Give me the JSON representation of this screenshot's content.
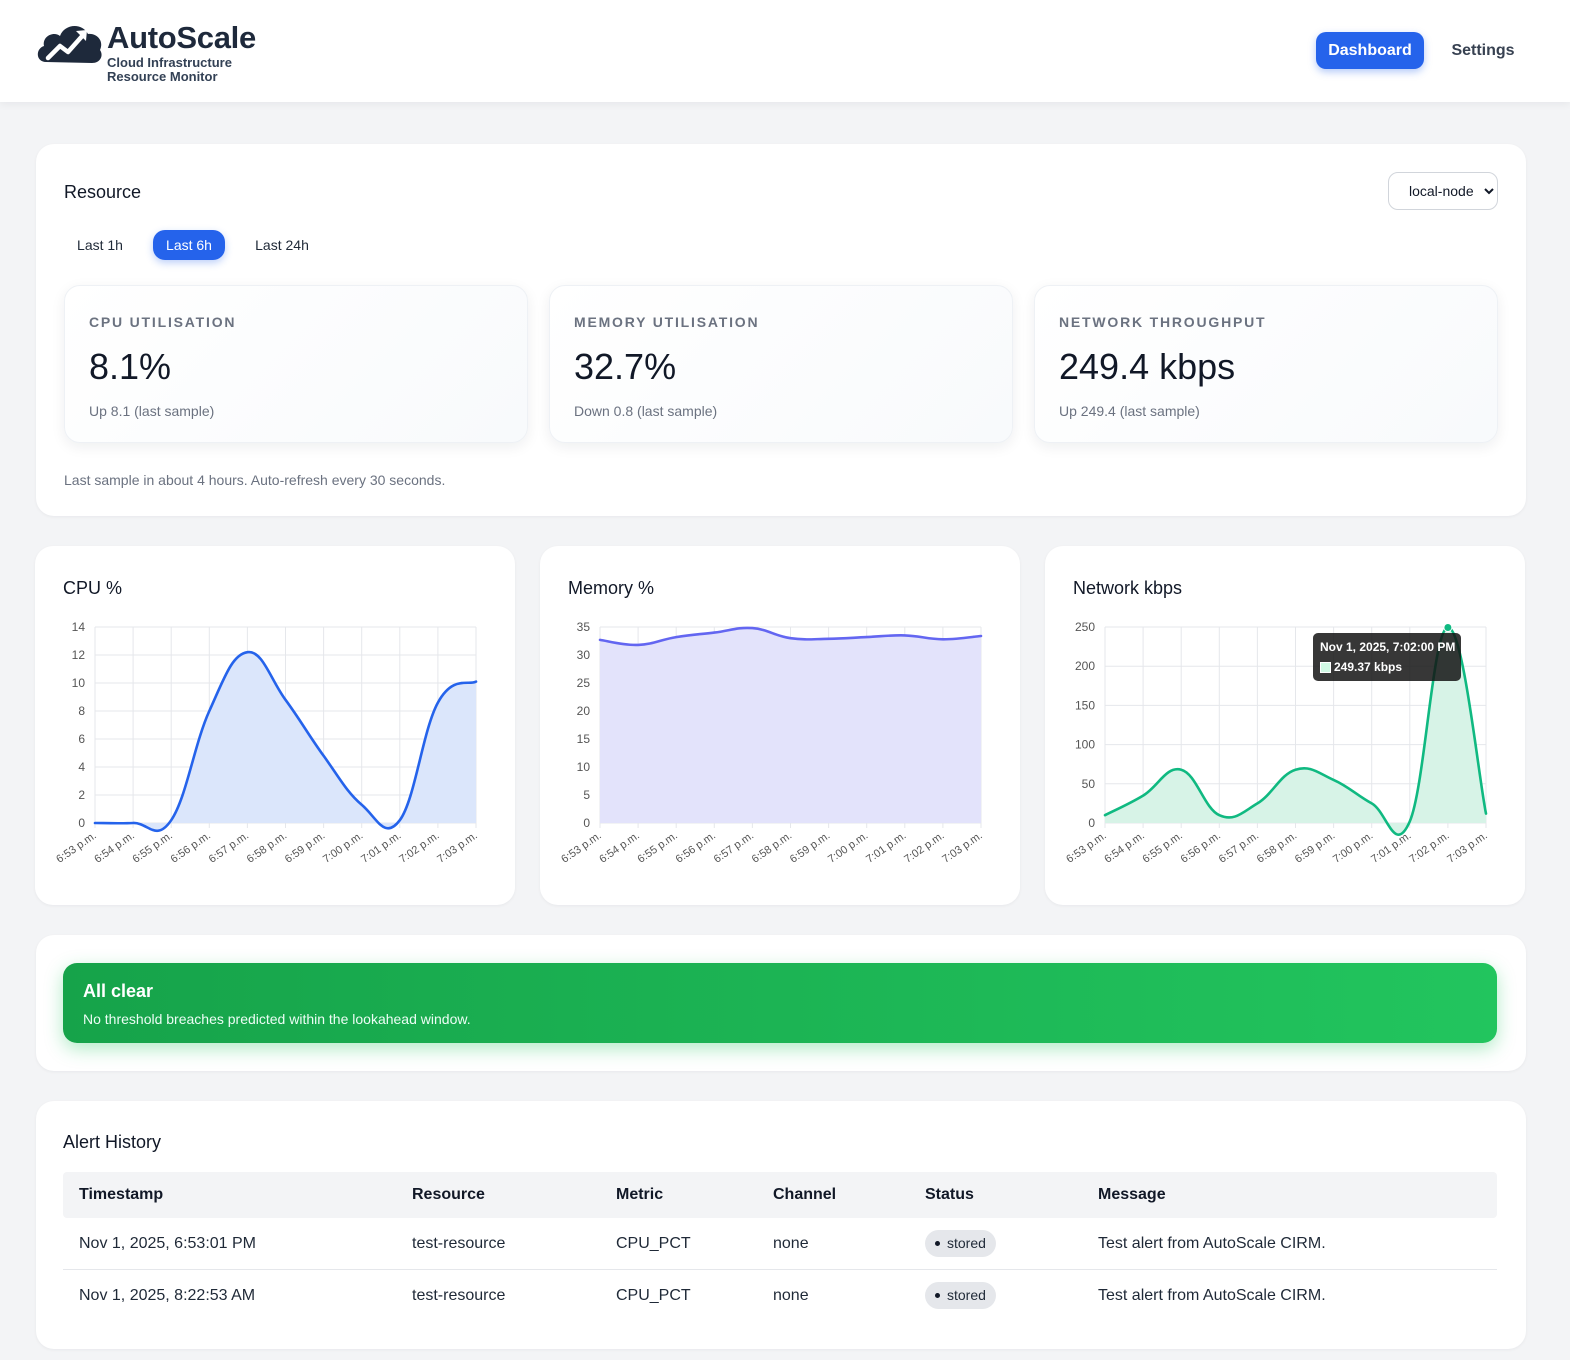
{
  "brand": {
    "name": "AutoScale",
    "subtitle_line1": "Cloud Infrastructure",
    "subtitle_line2": "Resource Monitor"
  },
  "nav": {
    "dashboard": "Dashboard",
    "settings": "Settings"
  },
  "resource": {
    "title": "Resource",
    "selected_node": "local-node",
    "ranges": [
      "Last 1h",
      "Last 6h",
      "Last 24h"
    ],
    "active_range": "Last 6h",
    "metrics": [
      {
        "label": "CPU UTILISATION",
        "value": "8.1%",
        "delta": "Up 8.1 (last sample)"
      },
      {
        "label": "MEMORY UTILISATION",
        "value": "32.7%",
        "delta": "Down 0.8 (last sample)"
      },
      {
        "label": "NETWORK THROUGHPUT",
        "value": "249.4 kbps",
        "delta": "Up 249.4 (last sample)"
      }
    ],
    "note": "Last sample in about 4 hours. Auto-refresh every 30 seconds."
  },
  "charts": {
    "cpu_title": "CPU %",
    "memory_title": "Memory %",
    "network_title": "Network kbps",
    "tooltip": {
      "title": "Nov 1, 2025, 7:02:00 PM",
      "value": "249.37 kbps"
    }
  },
  "chart_data": [
    {
      "type": "area",
      "title": "CPU %",
      "x": [
        "6:53 p.m.",
        "6:54 p.m.",
        "6:55 p.m.",
        "6:56 p.m.",
        "6:57 p.m.",
        "6:58 p.m.",
        "6:59 p.m.",
        "7:00 p.m.",
        "7:01 p.m.",
        "7:02 p.m.",
        "7:03 p.m."
      ],
      "series": [
        {
          "values": [
            0,
            0,
            0.2,
            8.0,
            12.2,
            8.8,
            4.8,
            1.3,
            0.2,
            8.6,
            10.1
          ]
        }
      ],
      "ylim": [
        0,
        14
      ],
      "yticks": [
        0,
        2,
        4,
        6,
        8,
        10,
        12,
        14
      ],
      "color": "#2563eb",
      "fill": "#dbe6fb",
      "grid": true
    },
    {
      "type": "area",
      "title": "Memory %",
      "x": [
        "6:53 p.m.",
        "6:54 p.m.",
        "6:55 p.m.",
        "6:56 p.m.",
        "6:57 p.m.",
        "6:58 p.m.",
        "6:59 p.m.",
        "7:00 p.m.",
        "7:01 p.m.",
        "7:02 p.m.",
        "7:03 p.m."
      ],
      "series": [
        {
          "values": [
            32.7,
            31.8,
            33.2,
            34.0,
            34.8,
            33.0,
            32.9,
            33.2,
            33.5,
            32.8,
            33.4
          ]
        }
      ],
      "ylim": [
        0,
        35
      ],
      "yticks": [
        0,
        5,
        10,
        15,
        20,
        25,
        30,
        35
      ],
      "color": "#6366f1",
      "fill": "#e3e3fb",
      "grid": true
    },
    {
      "type": "area",
      "title": "Network kbps",
      "x": [
        "6:53 p.m.",
        "6:54 p.m.",
        "6:55 p.m.",
        "6:56 p.m.",
        "6:57 p.m.",
        "6:58 p.m.",
        "6:59 p.m.",
        "7:00 p.m.",
        "7:01 p.m.",
        "7:02 p.m.",
        "7:03 p.m."
      ],
      "series": [
        {
          "values": [
            10,
            35,
            68,
            10,
            25,
            68,
            55,
            25,
            2,
            249.37,
            12
          ]
        }
      ],
      "ylim": [
        0,
        250
      ],
      "yticks": [
        0,
        50,
        100,
        150,
        200,
        250
      ],
      "color": "#10b981",
      "fill": "#d7f3e7",
      "grid": true,
      "highlight_index": 9
    }
  ],
  "status": {
    "title": "All clear",
    "text": "No threshold breaches predicted within the lookahead window."
  },
  "history": {
    "title": "Alert History",
    "columns": [
      "Timestamp",
      "Resource",
      "Metric",
      "Channel",
      "Status",
      "Message"
    ],
    "rows": [
      {
        "timestamp": "Nov 1, 2025, 6:53:01 PM",
        "resource": "test-resource",
        "metric": "CPU_PCT",
        "channel": "none",
        "status": "stored",
        "message": "Test alert from AutoScale CIRM."
      },
      {
        "timestamp": "Nov 1, 2025, 8:22:53 AM",
        "resource": "test-resource",
        "metric": "CPU_PCT",
        "channel": "none",
        "status": "stored",
        "message": "Test alert from AutoScale CIRM."
      }
    ]
  }
}
